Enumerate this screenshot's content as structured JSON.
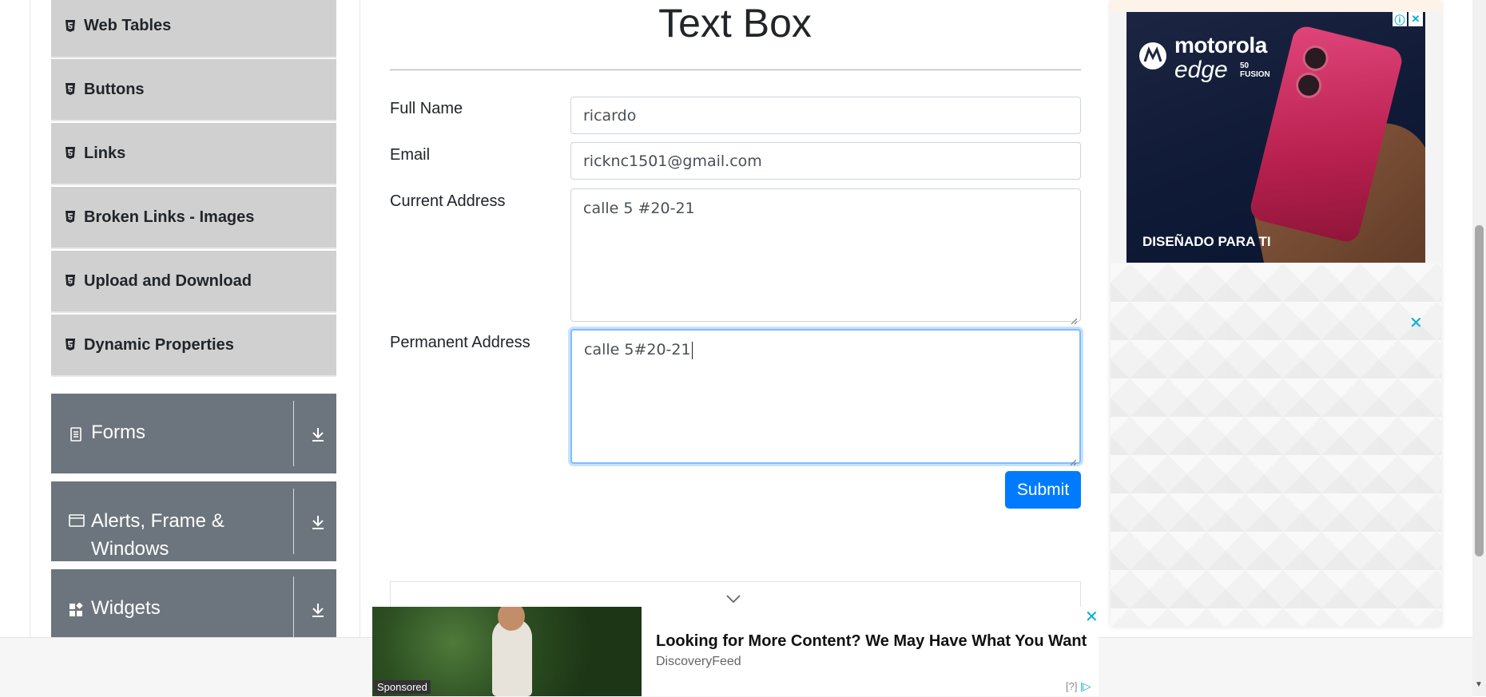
{
  "sidebar": {
    "items": [
      {
        "label": "Web Tables"
      },
      {
        "label": "Buttons"
      },
      {
        "label": "Links"
      },
      {
        "label": "Broken Links - Images"
      },
      {
        "label": "Upload and Download"
      },
      {
        "label": "Dynamic Properties"
      }
    ],
    "groups": [
      {
        "label": "Forms"
      },
      {
        "label_line1": "Alerts, Frame &",
        "label_line2": "Windows"
      },
      {
        "label": "Widgets"
      }
    ]
  },
  "main": {
    "title": "Text Box",
    "fields": {
      "full_name": {
        "label": "Full Name",
        "value": "ricardo"
      },
      "email": {
        "label": "Email",
        "value": "ricknc1501@gmail.com"
      },
      "current_address": {
        "label": "Current Address",
        "value": "calle 5 #20-21"
      },
      "permanent_address": {
        "label": "Permanent Address",
        "value": "calle 5#20-21"
      }
    },
    "submit_label": "Submit"
  },
  "right_ad": {
    "brand": "motorola",
    "model": "edge",
    "model_sub_line1": "50",
    "model_sub_line2": "FUSION",
    "tagline": "DISEÑADO PARA TI",
    "info_icon": "info-icon",
    "close_icon": "close-icon"
  },
  "bottom_ad": {
    "sponsored_label": "Sponsored",
    "headline": "Looking for More Content? We May Have What You Want",
    "source": "DiscoveryFeed",
    "info_text": "[?]"
  },
  "colors": {
    "sidebar_item_bg": "#d0d0d0",
    "group_bg": "#6c757d",
    "submit_bg": "#007bff",
    "focus_border": "#80bdff",
    "ad_close": "#00aecd"
  }
}
